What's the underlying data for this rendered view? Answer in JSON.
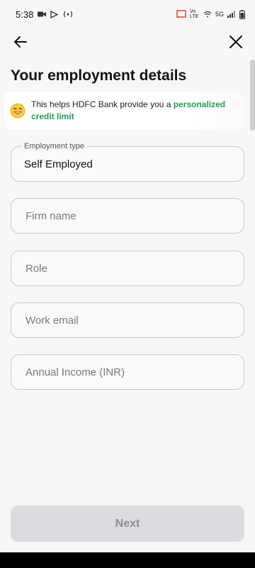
{
  "status_bar": {
    "time": "5:38",
    "network": "5G",
    "vo_lte": "Vo LTE"
  },
  "header": {
    "back_icon": "arrow-left-icon",
    "close_icon": "close-icon"
  },
  "page": {
    "title": "Your employment details"
  },
  "banner": {
    "emoji": "grinning-face-emoji",
    "text": "This helps HDFC Bank provide you a ",
    "highlight": "personalized credit limit",
    "highlight_color": "#1f9e5c"
  },
  "form": {
    "employment_type": {
      "label": "Employment type",
      "value": "Self Employed"
    },
    "firm_name": {
      "placeholder": "Firm name"
    },
    "role": {
      "placeholder": "Role"
    },
    "work_email": {
      "placeholder": "Work email"
    },
    "annual_income": {
      "placeholder": "Annual Income (INR)"
    }
  },
  "footer": {
    "next_label": "Next"
  }
}
